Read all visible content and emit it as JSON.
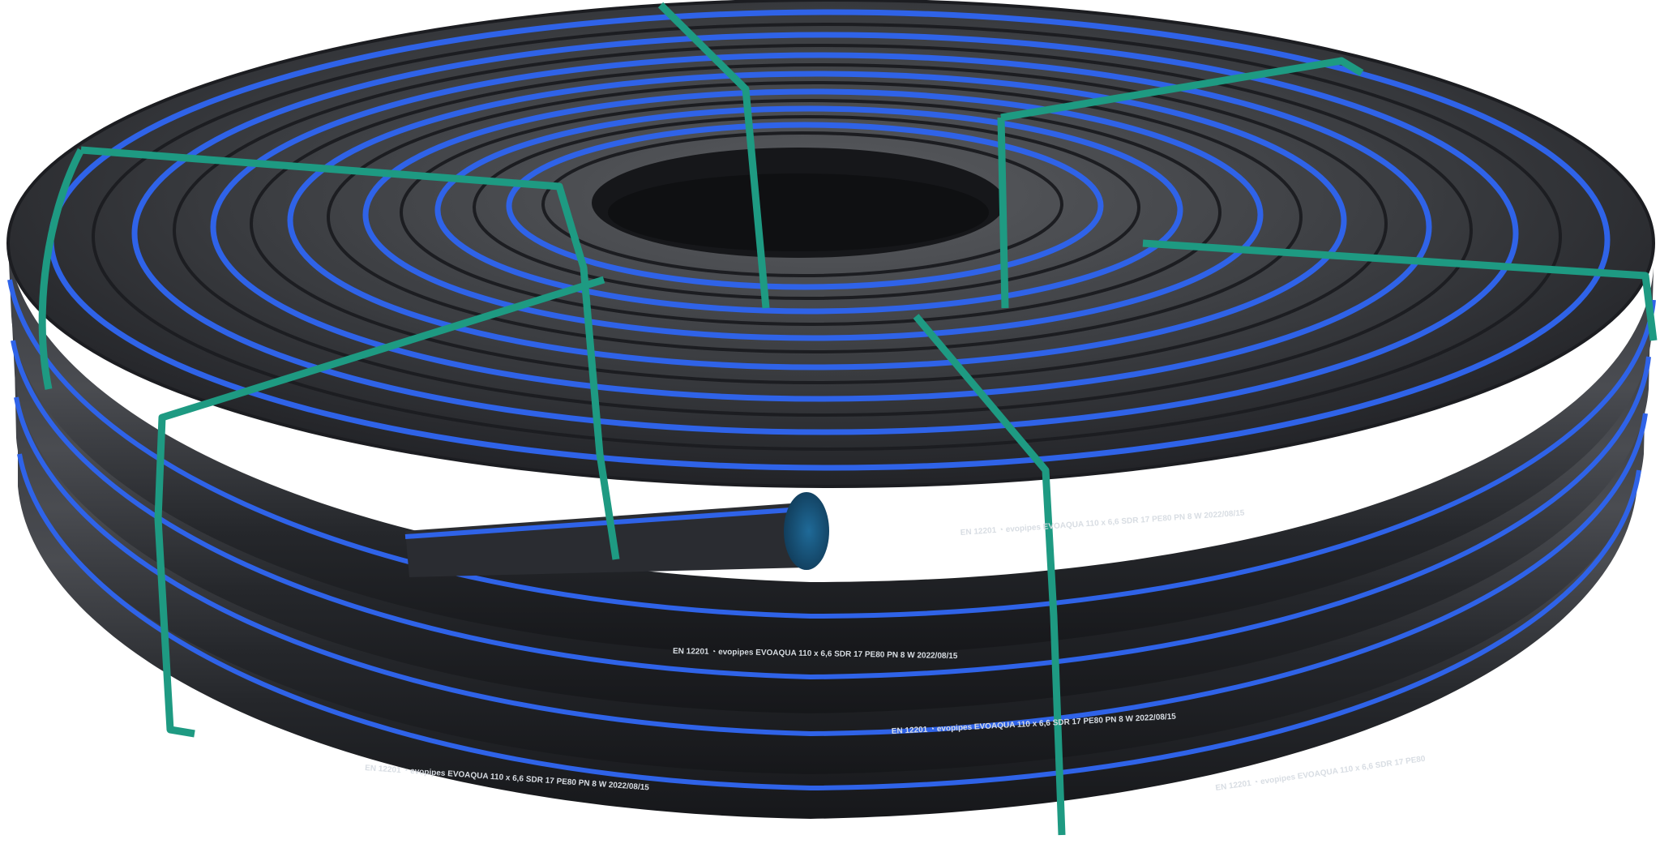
{
  "image": {
    "subject": "coil of black HDPE pipe with blue stripes strapped with green straps",
    "background": "#ffffff",
    "colors": {
      "pipe": "#2a2c31",
      "pipe_highlight": "#6c6e73",
      "stripe": "#2f63e8",
      "strap": "#1e9a82",
      "print": "#d8dde3",
      "pipe_end": "#1d5f8a"
    },
    "pipe_marking": {
      "standard": "EN 12201",
      "brand": "EVOAQUA",
      "size": "110 x 6,6",
      "sdr": "SDR 17",
      "material": "PE80",
      "pressure": "PN 8",
      "mark": "W",
      "date": "2022/08/15"
    }
  }
}
